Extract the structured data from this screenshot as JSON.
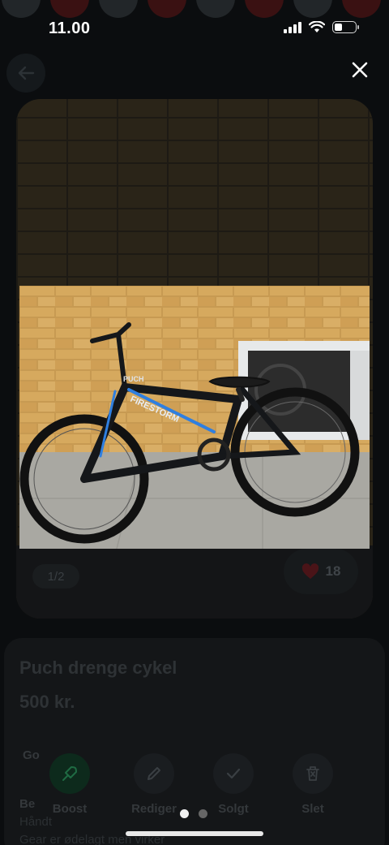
{
  "status_bar": {
    "time": "11.00",
    "battery_percent": 38
  },
  "listing": {
    "title": "Puch drenge cykel",
    "price": "500 kr.",
    "field_go": "Go",
    "field_be": "Be",
    "description_lines": [
      "Håndt",
      "Gear er ødelagt men virker"
    ]
  },
  "gallery": {
    "page_indicator": "1/2",
    "likes": "18"
  },
  "actions": {
    "boost": "Boost",
    "edit": "Rediger",
    "sold": "Solgt",
    "delete": "Slet"
  },
  "photo": {
    "frame_text": "FIRESTORM",
    "brand_text": "PUCH"
  },
  "colors": {
    "heart": "#e0303c",
    "accent_green": "#1f8a4c",
    "frame_blue": "#2f7fe0"
  }
}
